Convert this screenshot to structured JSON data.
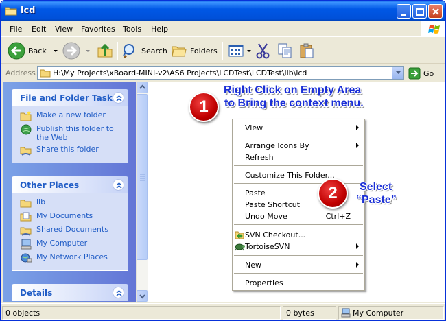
{
  "window": {
    "title": "lcd"
  },
  "menu": [
    "File",
    "Edit",
    "View",
    "Favorites",
    "Tools",
    "Help"
  ],
  "toolbar": {
    "back": "Back",
    "search": "Search",
    "folders": "Folders"
  },
  "address": {
    "label": "Address",
    "path": "H:\\My Projects\\xBoard-MINI-v2\\AS6 Projects\\LCDTest\\LCDTest\\lib\\lcd",
    "go": "Go"
  },
  "tasks": {
    "file_folder": {
      "title": "File and Folder Tasks",
      "items": [
        "Make a new folder",
        "Publish this folder to the Web",
        "Share this folder"
      ]
    },
    "other_places": {
      "title": "Other Places",
      "items": [
        "lib",
        "My Documents",
        "Shared Documents",
        "My Computer",
        "My Network Places"
      ]
    },
    "details": {
      "title": "Details"
    }
  },
  "context_menu": {
    "view": "View",
    "arrange": "Arrange Icons By",
    "refresh": "Refresh",
    "customize": "Customize This Folder...",
    "paste": "Paste",
    "paste_shortcut": "Paste Shortcut",
    "undo_move": "Undo Move",
    "undo_shortcut": "Ctrl+Z",
    "svn_checkout": "SVN Checkout...",
    "tortoise": "TortoiseSVN",
    "new": "New",
    "properties": "Properties"
  },
  "callouts": {
    "step1": {
      "number": "1",
      "line1": "Right Click on Empty Area",
      "line2": "to Bring the context menu."
    },
    "step2": {
      "number": "2",
      "line1": "Select",
      "line2": "“Paste”"
    }
  },
  "status": {
    "objects": "0 objects",
    "size": "0 bytes",
    "location": "My Computer"
  },
  "colors": {
    "titlebar": "#0054E3",
    "task_link": "#215DC6",
    "callout_text": "#1A2FD6",
    "badge": "#C00000"
  }
}
